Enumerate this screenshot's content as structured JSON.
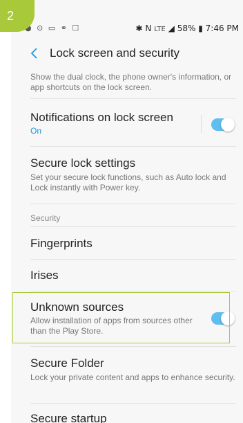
{
  "step_badge": "2",
  "status_bar": {
    "left_icons": "● ⊙ ▭ ⚭ ☐",
    "bluetooth_nfc": "✱ N",
    "network": "LTE",
    "battery": "58%",
    "battery_icon": "battery-icon",
    "time": "7:46 PM"
  },
  "app_bar": {
    "title": "Lock screen and security",
    "back_icon": "chevron-left-icon"
  },
  "top_description": "Show the dual clock, the phone owner's information, or app shortcuts on the lock screen.",
  "items": {
    "notifications": {
      "title": "Notifications on lock screen",
      "status": "On",
      "toggle_on": true
    },
    "secure_lock": {
      "title": "Secure lock settings",
      "description": "Set your secure lock functions, such as Auto lock and Lock instantly with Power key."
    },
    "security_header": "Security",
    "fingerprints": {
      "title": "Fingerprints"
    },
    "irises": {
      "title": "Irises"
    },
    "unknown_sources": {
      "title": "Unknown sources",
      "description": "Allow installation of apps from sources other than the Play Store.",
      "toggle_on": true
    },
    "secure_folder": {
      "title": "Secure Folder",
      "description": "Lock your private content and apps to enhance security."
    },
    "secure_startup": {
      "title": "Secure startup"
    }
  },
  "colors": {
    "accent_toggle": "#5fbef0",
    "status_blue": "#2196d9",
    "highlight_green": "#a8c93a"
  }
}
